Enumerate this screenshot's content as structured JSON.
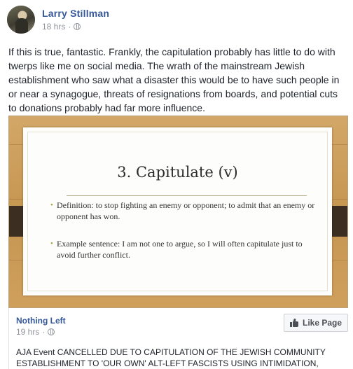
{
  "post": {
    "author": "Larry Stillman",
    "time": "18 hrs",
    "separator": "·",
    "privacy_icon": "globe-icon",
    "text": "If this is true, fantastic. Frankly, the capitulation probably has little to do with twerps like me on social media. The wrath of the mainstream Jewish establishment who saw what a disaster this would be to have such people in or near a synagogue, threats of resignations from boards, and potential cuts to donations probably had far more influence."
  },
  "slide": {
    "title": "3.  Capitulate (v)",
    "bullets": [
      "Definition:  to stop fighting an enemy or opponent; to admit that an enemy or opponent has won.",
      "Example sentence:  I am not one to argue, so I will often capitulate just to avoid further conflict."
    ],
    "bullet_glyph": "•"
  },
  "shared": {
    "page_name": "Nothing Left",
    "time": "19 hrs",
    "separator": "·",
    "privacy_icon": "globe-icon",
    "like_label": "Like Page",
    "like_icon": "thumbs-up-icon",
    "text": "AJA Event CANCELLED DUE TO CAPITULATION OF THE JEWISH COMMUNITY ESTABLISHMENT TO 'OUR OWN' ALT-LEFT FASCISTS USING INTIMIDATION,"
  },
  "colors": {
    "link": "#365899",
    "meta": "#90949c",
    "wood": "#c79a59",
    "tab": "#3d2e22"
  }
}
